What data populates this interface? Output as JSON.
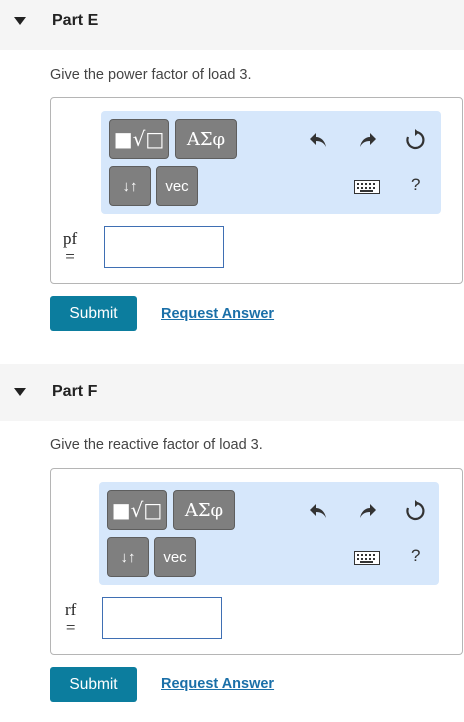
{
  "parts": [
    {
      "title": "Part E",
      "prompt": "Give the power factor of load 3.",
      "var_label": "pf",
      "equals": "=",
      "input_value": "",
      "toolbar": {
        "templates_label": "■√□",
        "greek_label": "ΑΣφ",
        "arrows_label": "↓↑",
        "vec_label": "vec",
        "help_label": "?"
      },
      "submit_label": "Submit",
      "request_label": "Request Answer"
    },
    {
      "title": "Part F",
      "prompt": "Give the reactive factor of load 3.",
      "var_label": "rf",
      "equals": "=",
      "input_value": "",
      "toolbar": {
        "templates_label": "■√□",
        "greek_label": "ΑΣφ",
        "arrows_label": "↓↑",
        "vec_label": "vec",
        "help_label": "?"
      },
      "submit_label": "Submit",
      "request_label": "Request Answer"
    }
  ],
  "colors": {
    "submit_bg": "#0c7d9e",
    "toolbar_bg": "#d6e7fb",
    "link": "#1a6fa8",
    "input_border": "#3f6fb3"
  },
  "icons": [
    "undo-icon",
    "redo-icon",
    "reset-icon",
    "keyboard-icon"
  ]
}
